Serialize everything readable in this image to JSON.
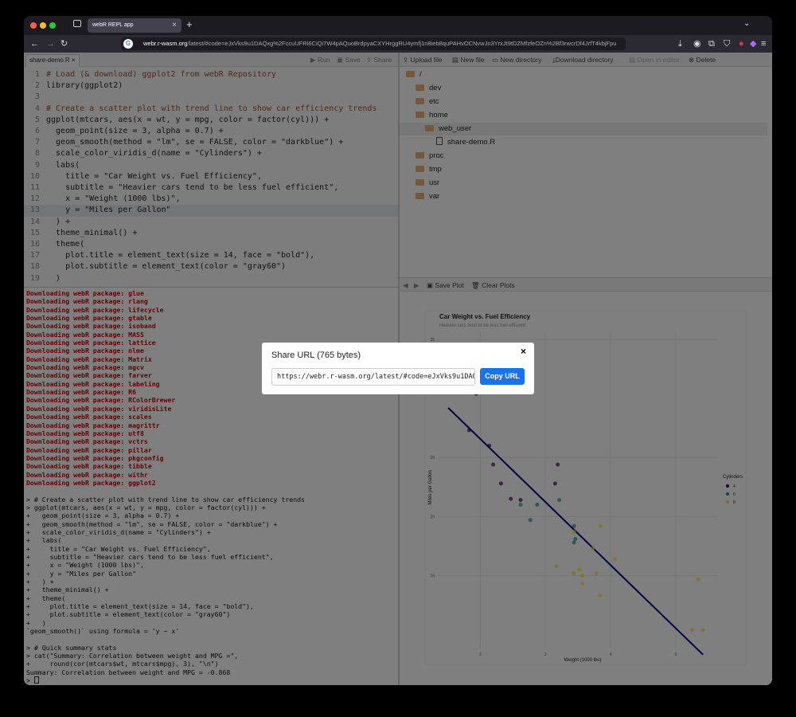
{
  "browser": {
    "tab_title": "webR REPL app",
    "url_prefix": "webr.",
    "url_domain": "r-wasm.org",
    "url_rest": "/latest/#code=eJxVks9u1DAQxg%2FccuUFRi6CiQi7W4pAQuoBrdpyaCXYHrggRU4ymfj1n8ieb8quPAHvOCNvwJn3YrxJt9tDZMfzfeOZn%2Bf3rwcrDf4JrfT4kbjFpu"
  },
  "editor": {
    "tab_name": "share-demo.R",
    "toolbar": {
      "run": "Run",
      "save": "Save",
      "share": "Share"
    },
    "lines": [
      {
        "n": "1",
        "code": "# Load (& download) ggplot2 from webR Repository"
      },
      {
        "n": "2",
        "code": "library(ggplot2)"
      },
      {
        "n": "3",
        "code": ""
      },
      {
        "n": "4",
        "code": "# Create a scatter plot with trend line to show car efficiency trends"
      },
      {
        "n": "5",
        "code": "ggplot(mtcars, aes(x = wt, y = mpg, color = factor(cyl))) +"
      },
      {
        "n": "6",
        "code": "  geom_point(size = 3, alpha = 0.7) +"
      },
      {
        "n": "7",
        "code": "  geom_smooth(method = \"lm\", se = FALSE, color = \"darkblue\") +"
      },
      {
        "n": "8",
        "code": "  scale_color_viridis_d(name = \"Cylinders\") +"
      },
      {
        "n": "9",
        "code": "  labs("
      },
      {
        "n": "10",
        "code": "    title = \"Car Weight vs. Fuel Efficiency\","
      },
      {
        "n": "11",
        "code": "    subtitle = \"Heavier cars tend to be less fuel efficient\","
      },
      {
        "n": "12",
        "code": "    x = \"Weight (1000 lbs)\","
      },
      {
        "n": "13",
        "code": "    y = \"Miles per Gallon\""
      },
      {
        "n": "14",
        "code": "  ) +"
      },
      {
        "n": "15",
        "code": "  theme_minimal() +"
      },
      {
        "n": "16",
        "code": "  theme("
      },
      {
        "n": "17",
        "code": "    plot.title = element_text(size = 14, face = \"bold\"),"
      },
      {
        "n": "18",
        "code": "    plot.subtitle = element_text(color = \"gray60\")"
      },
      {
        "n": "19",
        "code": "  )"
      }
    ]
  },
  "console": {
    "downloads": [
      "glue",
      "rlang",
      "lifecycle",
      "gtable",
      "isoband",
      "MASS",
      "lattice",
      "nlme",
      "Matrix",
      "mgcv",
      "farver",
      "labeling",
      "R6",
      "RColorBrewer",
      "viridisLite",
      "scales",
      "magrittr",
      "utf8",
      "vctrs",
      "pillar",
      "pkgconfig",
      "tibble",
      "withr",
      "ggplot2"
    ],
    "download_prefix": "Downloading webR package: ",
    "lines": [
      "> # Create a scatter plot with trend line to show car efficiency trends",
      "> ggplot(mtcars, aes(x = wt, y = mpg, color = factor(cyl))) +",
      "+   geom_point(size = 3, alpha = 0.7) +",
      "+   geom_smooth(method = \"lm\", se = FALSE, color = \"darkblue\") +",
      "+   scale_color_viridis_d(name = \"Cylinders\") +",
      "+   labs(",
      "+     title = \"Car Weight vs. Fuel Efficiency\",",
      "+     subtitle = \"Heavier cars tend to be less fuel efficient\",",
      "+     x = \"Weight (1000 lbs)\",",
      "+     y = \"Miles per Gallon\"",
      "+   ) +",
      "+   theme_minimal() +",
      "+   theme(",
      "+     plot.title = element_text(size = 14, face = \"bold\"),",
      "+     plot.subtitle = element_text(color = \"gray60\")",
      "+   )",
      "`geom_smooth()` using formula = 'y ~ x'",
      "",
      "> # Quick summary stats",
      "> cat(\"Summary: Correlation between weight and MPG =\",",
      "+     round(cor(mtcars$wt, mtcars$mpg), 3), \"\\n\")",
      "Summary: Correlation between weight and MPG = -0.868",
      "> "
    ]
  },
  "files": {
    "toolbar": {
      "upload": "Upload file",
      "new_file": "New file",
      "new_dir": "New directory",
      "download_dir": "Download directory",
      "open_editor": "Open in editor",
      "delete": "Delete"
    },
    "tree": {
      "root": "/",
      "dev": "dev",
      "etc": "etc",
      "home": "home",
      "web_user": "web_user",
      "share_demo": "share-demo.R",
      "proc": "proc",
      "tmp": "tmp",
      "usr": "usr",
      "var": "var"
    }
  },
  "plots": {
    "toolbar": {
      "save": "Save Plot",
      "clear": "Clear Plots"
    }
  },
  "chart_data": {
    "type": "scatter",
    "title": "Car Weight vs. Fuel Efficiency",
    "subtitle": "Heavier cars tend to be less fuel efficient",
    "xlabel": "Weight (1000 lbs)",
    "ylabel": "Miles per Gallon",
    "xlim": [
      1.35,
      5.6
    ],
    "ylim": [
      9.5,
      35
    ],
    "x_ticks": [
      "2",
      "3",
      "4",
      "5"
    ],
    "y_ticks": [
      "15",
      "20",
      "25",
      "35"
    ],
    "legend_title": "Cylinders",
    "legend_position": "right",
    "grid": true,
    "series": [
      {
        "name": "4",
        "color": "#440154",
        "x": [
          2.32,
          2.2,
          3.19,
          3.15,
          2.47,
          2.14,
          1.83,
          2.62,
          1.94,
          1.51,
          2.78
        ],
        "y": [
          22.8,
          24.4,
          24.4,
          22.8,
          21.5,
          26.0,
          27.3,
          21.4,
          30.4,
          33.9,
          32.4
        ]
      },
      {
        "name": "6",
        "color": "#21908C",
        "x": [
          2.62,
          2.875,
          3.215,
          3.46,
          3.44,
          3.44,
          2.77
        ],
        "y": [
          21.0,
          21.0,
          21.4,
          18.1,
          19.2,
          17.8,
          19.7
        ]
      },
      {
        "name": "8",
        "color": "#FDE725",
        "x": [
          3.44,
          3.57,
          4.07,
          3.73,
          3.78,
          5.25,
          5.42,
          5.345,
          3.52,
          3.435,
          3.84,
          3.845,
          3.17,
          3.57
        ],
        "y": [
          18.7,
          14.3,
          16.4,
          17.3,
          15.2,
          10.4,
          10.4,
          14.7,
          15.5,
          15.2,
          13.3,
          19.2,
          15.8,
          15.0
        ]
      }
    ],
    "trend_line": {
      "color": "#00008B",
      "x": [
        1.51,
        5.42
      ],
      "y": [
        29.2,
        8.3
      ]
    }
  },
  "share_dialog": {
    "title": "Share URL (765 bytes)",
    "url_value": "https://webr.r-wasm.org/latest/#code=eJxVks9u1DAQxg",
    "copy_label": "Copy URL",
    "close": "×"
  }
}
